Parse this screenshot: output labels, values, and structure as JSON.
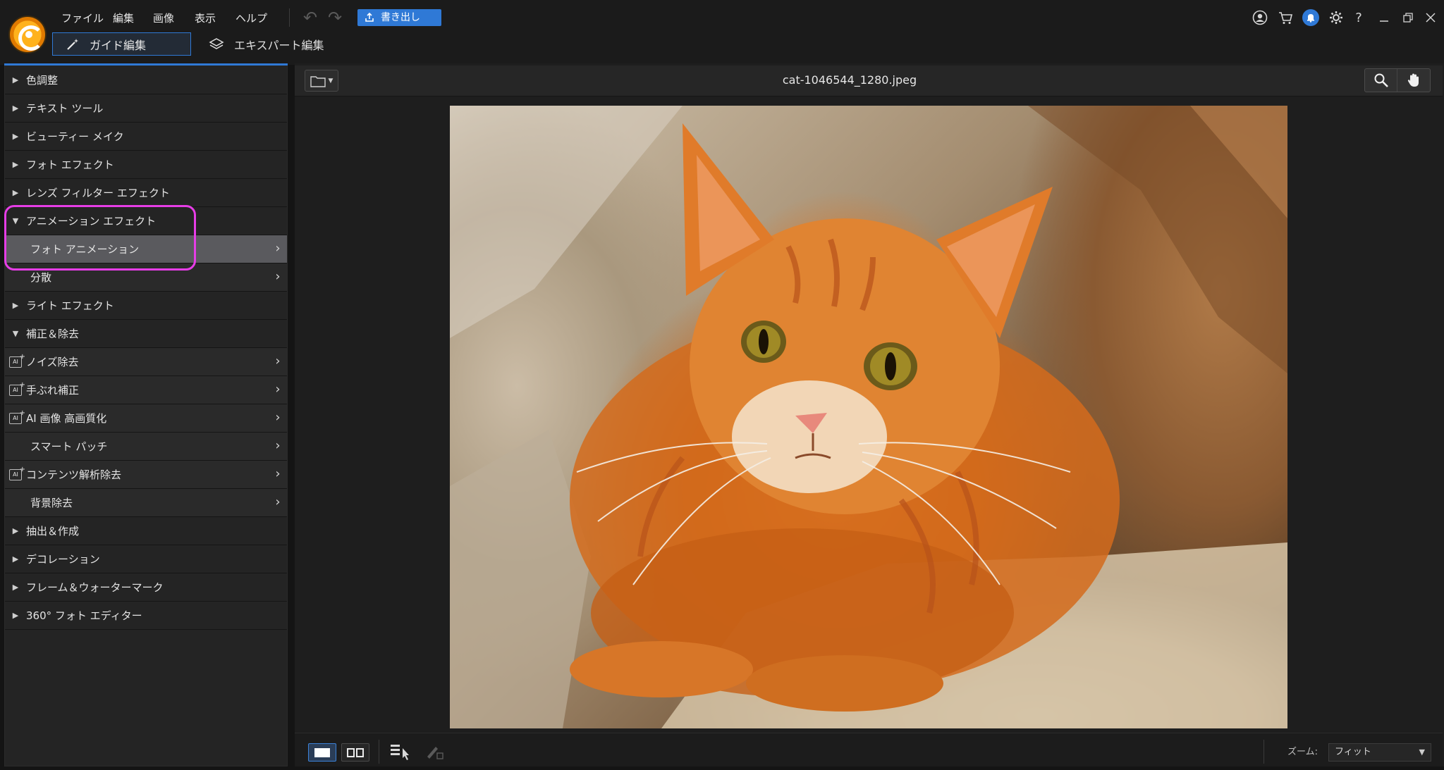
{
  "menu": {
    "file": "ファイル",
    "edit": "編集",
    "image": "画像",
    "view": "表示",
    "help": "ヘルプ"
  },
  "toolbar": {
    "export_label": "書き出し"
  },
  "modes": {
    "guide": "ガイド編集",
    "expert": "エキスパート編集"
  },
  "sidebar": {
    "items": [
      {
        "label": "色調整"
      },
      {
        "label": "テキスト ツール"
      },
      {
        "label": "ビューティー メイク"
      },
      {
        "label": "フォト エフェクト"
      },
      {
        "label": "レンズ フィルター エフェクト"
      },
      {
        "label": "アニメーション エフェクト"
      },
      {
        "label": "フォト アニメーション"
      },
      {
        "label": "分散"
      },
      {
        "label": "ライト エフェクト"
      },
      {
        "label": "補正＆除去"
      },
      {
        "label": "ノイズ除去"
      },
      {
        "label": "手ぶれ補正"
      },
      {
        "label": "AI 画像 高画質化"
      },
      {
        "label": "スマート パッチ"
      },
      {
        "label": "コンテンツ解析除去"
      },
      {
        "label": "背景除去"
      },
      {
        "label": "抽出＆作成"
      },
      {
        "label": "デコレーション"
      },
      {
        "label": "フレーム＆ウォーターマーク"
      },
      {
        "label": "360° フォト エディター"
      }
    ]
  },
  "viewer": {
    "file_name": "cat-1046544_1280.jpeg"
  },
  "bottom": {
    "zoom_label": "ズーム:",
    "zoom_value": "フィット"
  },
  "colors": {
    "accent": "#2f79d6",
    "highlight": "#e63de6",
    "selected_row": "#5a5a5e"
  }
}
